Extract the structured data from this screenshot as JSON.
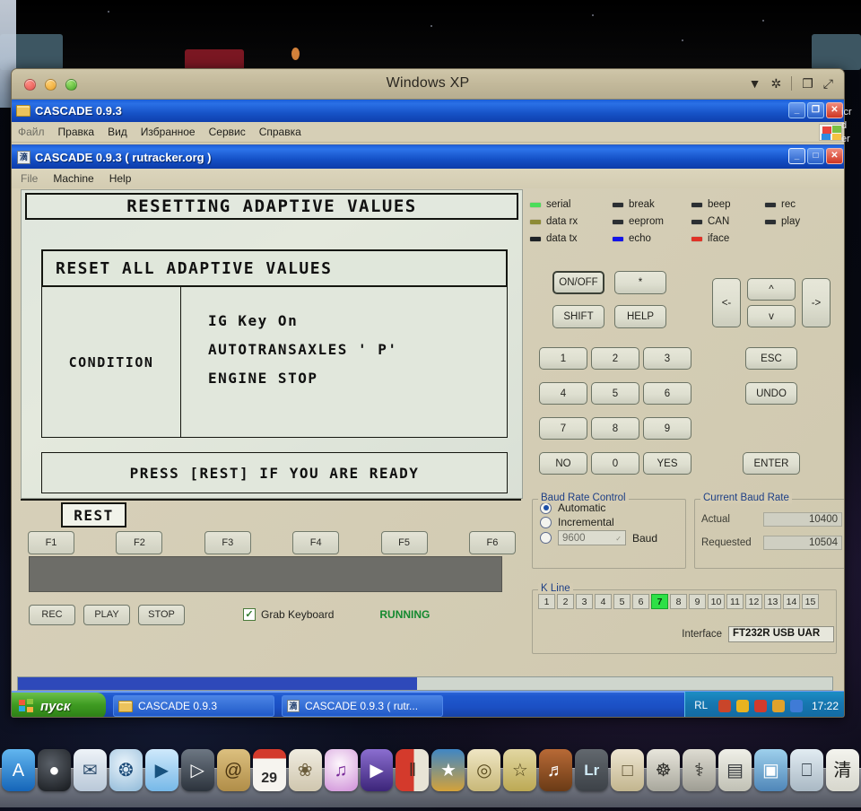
{
  "mac_window": {
    "title": "Windows XP",
    "traffic_lights": [
      "close-red",
      "minimize-yellow",
      "maximize-green"
    ],
    "toolbar_icons": [
      "chevron-down-icon",
      "gear-icon",
      "windows-restore-icon",
      "fullscreen-icon"
    ]
  },
  "explorer_window": {
    "title": "CASCADE 0.9.3",
    "icon": "folder-icon",
    "menu": [
      "Файл",
      "Правка",
      "Вид",
      "Избранное",
      "Сервис",
      "Справка"
    ],
    "window_buttons": [
      "_",
      "❐",
      "✕"
    ]
  },
  "cascade_window": {
    "title": "CASCADE 0.9.3 ( rutracker.org )",
    "icon": "app-icon",
    "menu": [
      "File",
      "Machine",
      "Help"
    ],
    "window_buttons": [
      "_",
      "□",
      "✕"
    ]
  },
  "lcd": {
    "screen_title": "RESETTING ADAPTIVE VALUES",
    "reset_header": "RESET ALL ADAPTIVE VALUES",
    "condition_label": "CONDITION",
    "condition_lines": [
      "IG Key On",
      "AUTOTRANSAXLES ' P'",
      "ENGINE STOP"
    ],
    "prompt": "PRESS [REST] IF YOU ARE READY"
  },
  "softkeys": {
    "rest_label": "REST",
    "fkeys": [
      "F1",
      "F2",
      "F3",
      "F4",
      "F5",
      "F6"
    ]
  },
  "transport": {
    "buttons": [
      "REC",
      "PLAY",
      "STOP"
    ],
    "grab_keyboard_label": "Grab Keyboard",
    "grab_keyboard_checked": true,
    "grab_check_glyph": "✓",
    "status": "RUNNING",
    "status_color": "#14892f"
  },
  "leds": [
    {
      "label": "serial",
      "color": "#4bdc5a"
    },
    {
      "label": "break",
      "color": "#2b2f33"
    },
    {
      "label": "beep",
      "color": "#2b2f33"
    },
    {
      "label": "rec",
      "color": "#2b2f33"
    },
    {
      "label": "data rx",
      "color": "#8d8a34"
    },
    {
      "label": "eeprom",
      "color": "#2b2f33"
    },
    {
      "label": "CAN",
      "color": "#2b2f33"
    },
    {
      "label": "play",
      "color": "#2b2f33"
    },
    {
      "label": "data tx",
      "color": "#1e2226"
    },
    {
      "label": "echo",
      "color": "#1414e8"
    },
    {
      "label": "iface",
      "color": "#e03226"
    }
  ],
  "keypad": {
    "row_top": [
      "ON/OFF",
      "*"
    ],
    "row_second": [
      "SHIFT",
      "HELP"
    ],
    "digits": [
      "1",
      "2",
      "3",
      "4",
      "5",
      "6",
      "7",
      "8",
      "9"
    ],
    "row_bottom": [
      "NO",
      "0",
      "YES"
    ],
    "nav": {
      "left": "<-",
      "up": "^",
      "down": "v",
      "right": "->"
    },
    "actions": [
      "ESC",
      "UNDO",
      "ENTER"
    ]
  },
  "baud_rate_control": {
    "group_title": "Baud Rate Control",
    "options": [
      {
        "label": "Automatic",
        "selected": true
      },
      {
        "label": "Incremental",
        "selected": false
      },
      {
        "label": "",
        "selected": false
      }
    ],
    "manual_combo_value": "9600",
    "manual_combo_suffix": "Baud"
  },
  "current_baud_rate": {
    "group_title": "Current Baud Rate",
    "rows": [
      {
        "label": "Actual",
        "value": "10400"
      },
      {
        "label": "Requested",
        "value": "10504"
      }
    ]
  },
  "k_line": {
    "group_title": "K Line",
    "cells": [
      "1",
      "2",
      "3",
      "4",
      "5",
      "6",
      "7",
      "8",
      "9",
      "10",
      "11",
      "12",
      "13",
      "14",
      "15"
    ],
    "active": "7",
    "active_color": "#2ee046"
  },
  "interface": {
    "label": "Interface",
    "value": "FT232R USB UAR"
  },
  "xp_taskbar": {
    "start_label": "пуск",
    "tasks": [
      {
        "label": "CASCADE 0.9.3",
        "icon": "folder-icon"
      },
      {
        "label": "CASCADE 0.9.3 ( rutr...",
        "icon": "app-icon"
      }
    ],
    "tray_language": "RL",
    "tray_icons": [
      "network-icon",
      "shield-icon",
      "antivirus-icon",
      "update-icon",
      "battery-icon"
    ],
    "clock": "17:22"
  },
  "progress": {
    "percent": 49
  },
  "mac_dock": {
    "items": [
      {
        "name": "app-store",
        "glyph": "A",
        "bg": "#1f7fd4"
      },
      {
        "name": "dashboard",
        "glyph": "●",
        "bg": "#23262b"
      },
      {
        "name": "mail",
        "glyph": "✉",
        "bg": "#dfe6ef"
      },
      {
        "name": "safari",
        "glyph": "❂",
        "bg": "#cfe2f2"
      },
      {
        "name": "facetime",
        "glyph": "▶",
        "bg": "#9fd2f5"
      },
      {
        "name": "quicktime",
        "glyph": "▷",
        "bg": "#3b4450"
      },
      {
        "name": "address-book",
        "glyph": "@",
        "bg": "#c9a96a"
      },
      {
        "name": "calendar",
        "glyph": "29",
        "bg": "#f2efe8"
      },
      {
        "name": "iphoto",
        "glyph": "❀",
        "bg": "#e7e3d7"
      },
      {
        "name": "itunes",
        "glyph": "♫",
        "bg": "#f0eef5"
      },
      {
        "name": "quicktime-player",
        "glyph": "▶",
        "bg": "#5e3fa8"
      },
      {
        "name": "garageband-stack",
        "glyph": "‖",
        "bg": "#b02823"
      },
      {
        "name": "imovie",
        "glyph": "★",
        "bg": "#d8c76a"
      },
      {
        "name": "iphoto-alt",
        "glyph": "◎",
        "bg": "#e6dcc0"
      },
      {
        "name": "imovie-star",
        "glyph": "☆",
        "bg": "#cfc089"
      },
      {
        "name": "guitar",
        "glyph": "♬",
        "bg": "#8d5a2b"
      },
      {
        "name": "lightroom",
        "glyph": "Lr",
        "bg": "#4e5257"
      },
      {
        "name": "cans",
        "glyph": "□",
        "bg": "#d9cdb5"
      },
      {
        "name": "compass",
        "glyph": "☸",
        "bg": "#d6d3c8"
      },
      {
        "name": "stethoscope",
        "glyph": "⚕",
        "bg": "#cfccc2"
      },
      {
        "name": "window",
        "glyph": "▤",
        "bg": "#dcdcd2"
      },
      {
        "name": "display",
        "glyph": "▣",
        "bg": "#7fb4d8"
      },
      {
        "name": "imac",
        "glyph": "⎕",
        "bg": "#c9d4dd"
      },
      {
        "name": "cascade-vm",
        "glyph": "清",
        "bg": "#e8e8e2"
      }
    ]
  }
}
